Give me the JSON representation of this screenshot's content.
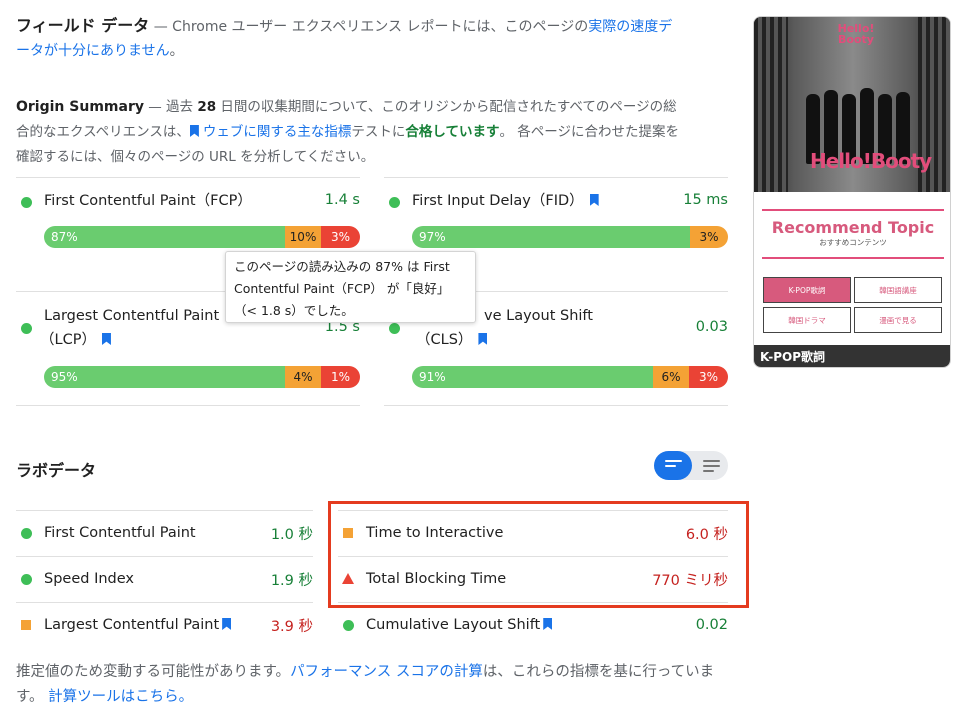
{
  "field": {
    "title": "フィールド データ",
    "desc_pre": " — Chrome ユーザー エクスペリエンス レポートには、このページの",
    "desc_link": "実際の速度データが十分にありません",
    "desc_post": "。"
  },
  "origin": {
    "title": "Origin Summary",
    "p1": " — 過去 ",
    "days": "28",
    "p2": " 日間の収集期間について、このオリジンから配信されたすべてのページの総合的なエクスペリエンスは、",
    "link": "ウェブに関する主な指標",
    "p3": "テストに",
    "pass": "合格しています",
    "p4": "。 各ページに合わせた提案を確認するには、個々のページの URL を分析してください。"
  },
  "metrics": [
    {
      "name": "First Contentful Paint（FCP）",
      "value": "1.4 s",
      "good": "87%",
      "ni": "10%",
      "poor": "3%"
    },
    {
      "name": "First Input Delay（FID）",
      "value": "15 ms",
      "good": "97%",
      "ni": "",
      "poor": "3%"
    },
    {
      "name_l1": "Largest Contentful Paint",
      "name_l2": "（LCP）",
      "value": "1.5 s",
      "good": "95%",
      "ni": "4%",
      "poor": "1%"
    },
    {
      "name_l1": "ve Layout Shift",
      "name_l2": "（CLS）",
      "value": "0.03",
      "good": "91%",
      "ni": "6%",
      "poor": "3%"
    }
  ],
  "tooltip": {
    "line1": "このページの読み込みの 87% は First",
    "line2": "Contentful Paint（FCP） が「良好」",
    "line3": "（< 1.8 s）でした。"
  },
  "lab": {
    "title": "ラボデータ",
    "items": [
      {
        "name": "First Contentful Paint",
        "value": "1.0 秒"
      },
      {
        "name": "Time to Interactive",
        "value": "6.0 秒"
      },
      {
        "name": "Speed Index",
        "value": "1.9 秒"
      },
      {
        "name": "Total Blocking Time",
        "value": "770 ミリ秒"
      },
      {
        "name": "Largest Contentful Paint",
        "value": "3.9 秒"
      },
      {
        "name": "Cumulative Layout Shift",
        "value": "0.02"
      }
    ]
  },
  "footer": {
    "p1": "推定値のため変動する可能性があります。",
    "link1": "パフォーマンス スコアの計算",
    "p2": "は、これらの指標を基に行っています。",
    "link2": "計算ツールはこちら。"
  },
  "thumbnail": {
    "logo": "Hello! Booty",
    "stage_title": "Hello!Booty",
    "rec_title": "Recommend Topic",
    "rec_sub": "おすすめコンテンツ",
    "buttons": [
      "K-POP歌詞",
      "韓国語講座",
      "韓国ドラマ",
      "漫画で見る"
    ],
    "caption": "K-POP歌詞"
  },
  "colors": {
    "good": "#6acc6f",
    "needs_improvement": "#f4a235",
    "poor": "#ea4335",
    "link": "#1a73e8",
    "highlight_box": "#e43b1f"
  }
}
